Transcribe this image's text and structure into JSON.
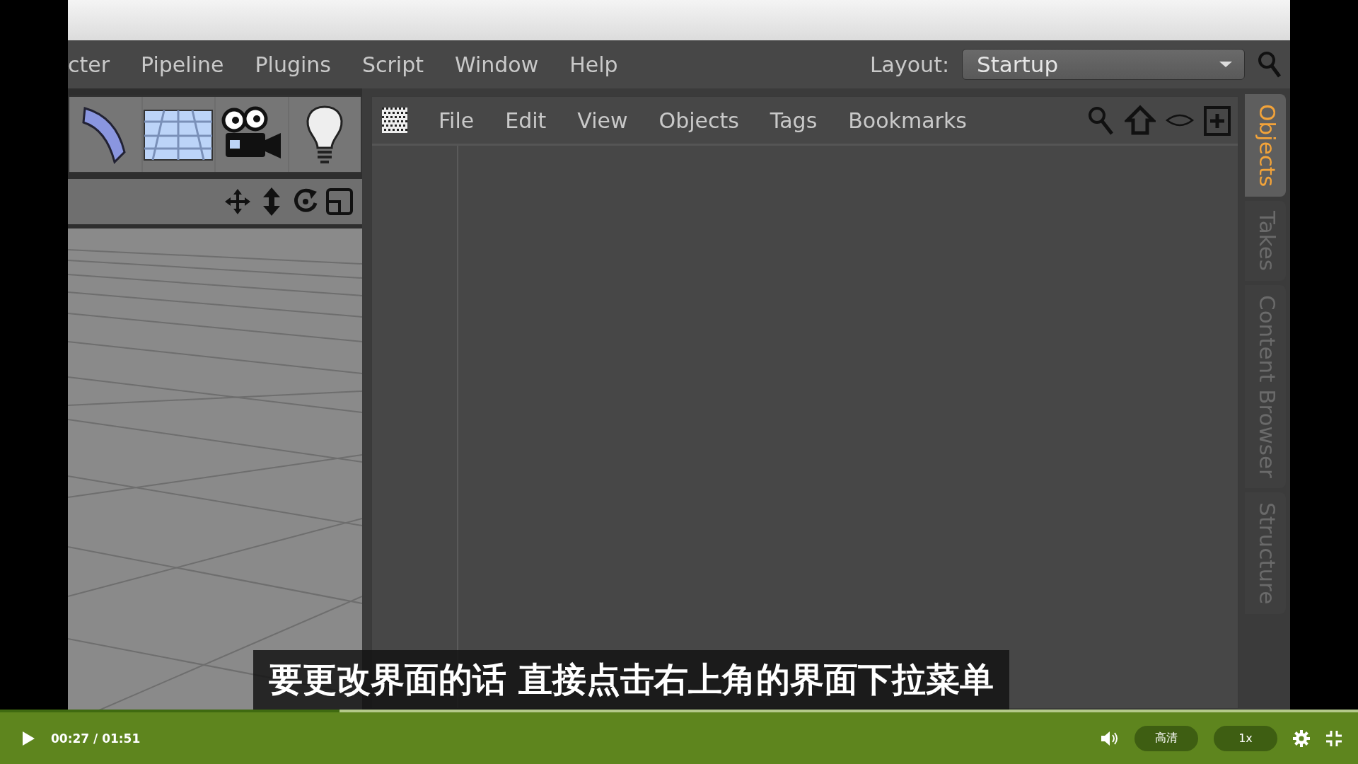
{
  "app": {
    "menu": [
      "cter",
      "Pipeline",
      "Plugins",
      "Script",
      "Window",
      "Help"
    ],
    "layout": {
      "label": "Layout:",
      "value": "Startup"
    },
    "object_manager": {
      "menu": [
        "File",
        "Edit",
        "View",
        "Objects",
        "Tags",
        "Bookmarks"
      ]
    },
    "side_tabs": [
      {
        "label": "Objects",
        "selected": true
      },
      {
        "label": "Takes",
        "selected": false
      },
      {
        "label": "Content Browser",
        "selected": false
      },
      {
        "label": "Structure",
        "selected": false
      }
    ]
  },
  "subtitle": "要更改界面的话 直接点击右上角的界面下拉菜单",
  "player": {
    "progress": {
      "level": 0.25
    },
    "time": "00:27 / 01:51",
    "quality": "高清",
    "speed": "1x"
  }
}
